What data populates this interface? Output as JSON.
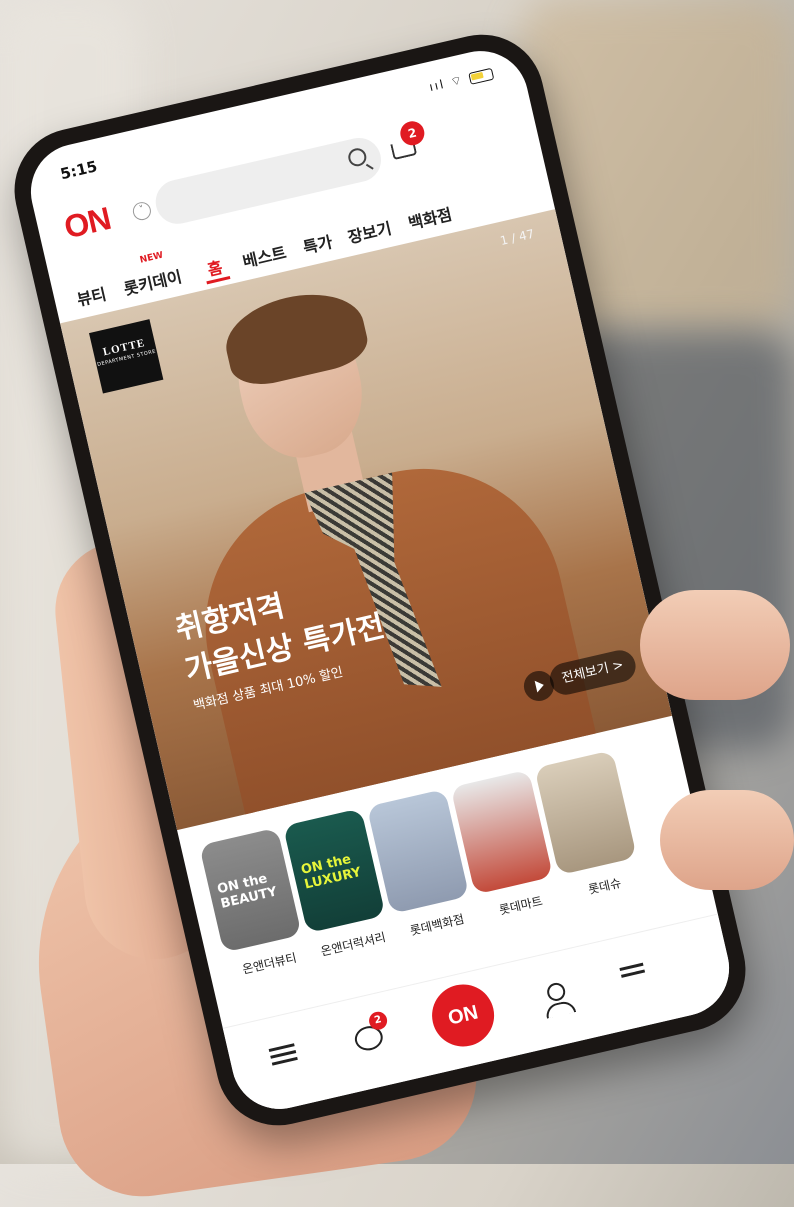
{
  "status_bar": {
    "time": "5:15",
    "signal": "ııl ⌔"
  },
  "header": {
    "logo": "ON",
    "cart_count": "2"
  },
  "tabs": [
    {
      "label": "뷰티"
    },
    {
      "label": "롯키데이",
      "badge": "NEW"
    },
    {
      "label": "홈",
      "active": true
    },
    {
      "label": "베스트"
    },
    {
      "label": "특가"
    },
    {
      "label": "장보기"
    },
    {
      "label": "백화점"
    }
  ],
  "hero": {
    "brand_name": "LOTTE",
    "brand_sub": "DEPARTMENT STORE",
    "counter": "1 / 47",
    "title_line1": "취향저격",
    "title_line2": "가을신상 특가전",
    "subtitle": "백화점 상품 최대 10% 할인",
    "view_all": "전체보기 >"
  },
  "shops": [
    {
      "label": "온앤더뷰티",
      "card_text": "ON the\nBEAUTY"
    },
    {
      "label": "온앤더럭셔리",
      "card_text": "ON the\nLUXURY"
    },
    {
      "label": "롯데백화점",
      "card_text": ""
    },
    {
      "label": "롯데마트",
      "card_text": ""
    },
    {
      "label": "롯데슈",
      "card_text": ""
    }
  ],
  "bottom_nav": {
    "center_label": "ON",
    "chat_count": "2"
  },
  "colors": {
    "brand_red": "#e01b22"
  }
}
